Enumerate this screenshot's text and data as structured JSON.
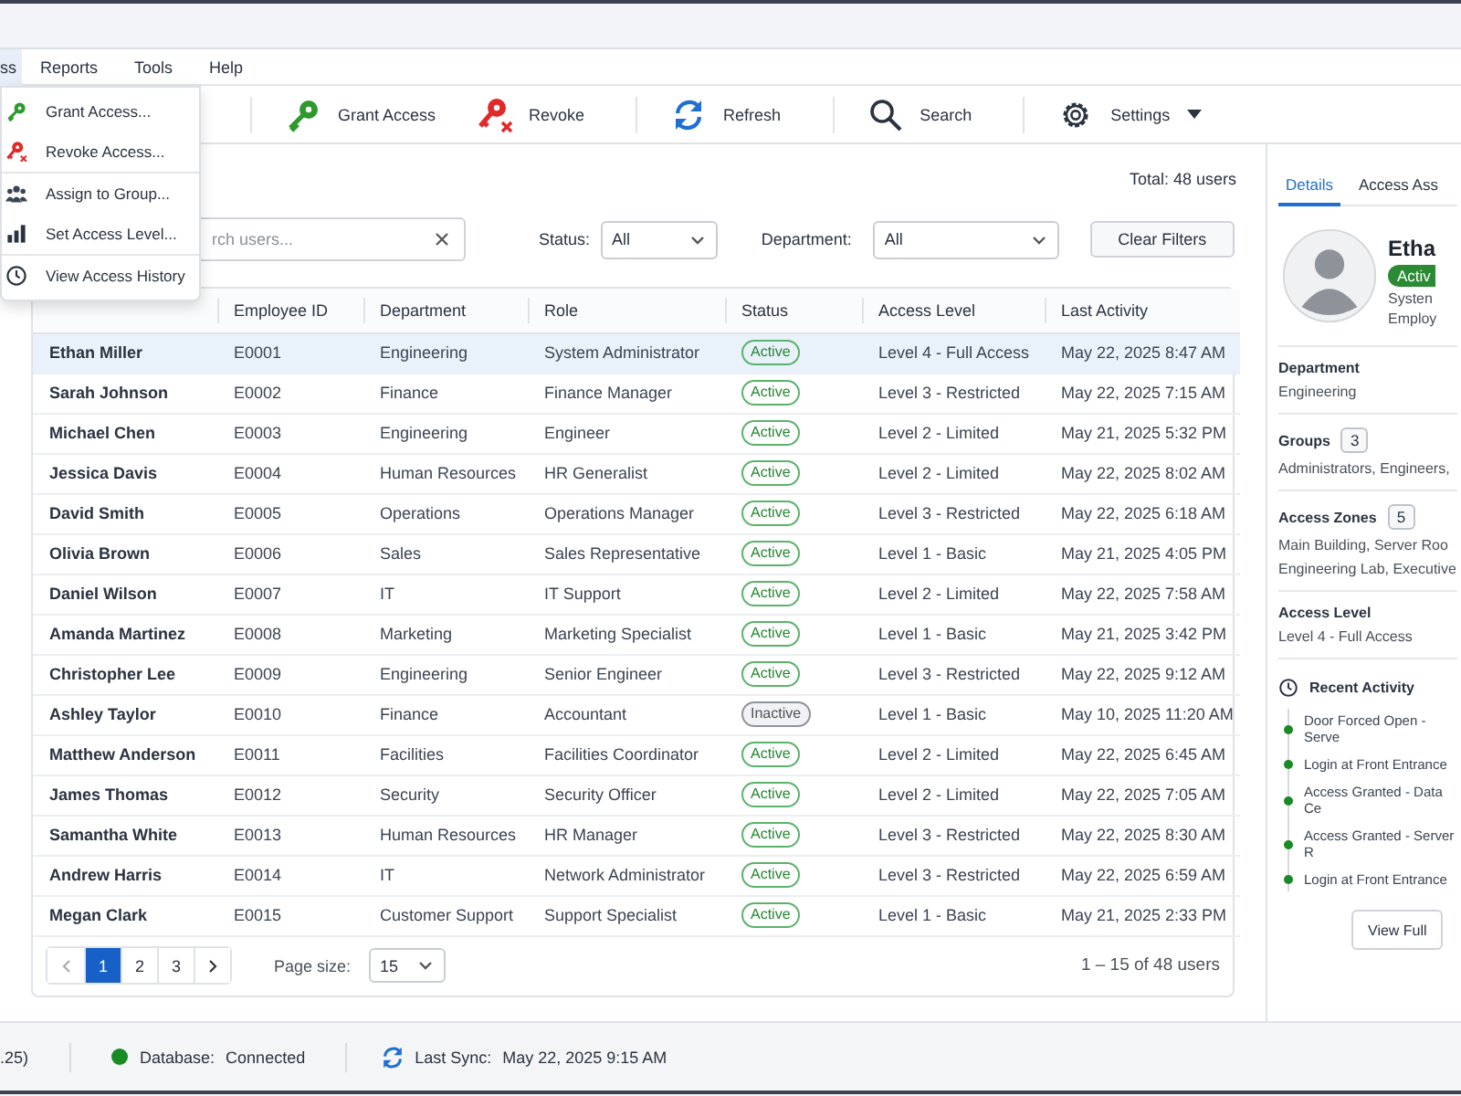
{
  "menubar": [
    {
      "label": "ss",
      "selected": true
    },
    {
      "label": "Reports",
      "selected": false
    },
    {
      "label": "Tools",
      "selected": false
    },
    {
      "label": "Help",
      "selected": false
    }
  ],
  "menu": {
    "groups": [
      [
        {
          "label": "Grant Access...",
          "kind": "grant"
        },
        {
          "label": "Revoke Access...",
          "kind": "revoke"
        }
      ],
      [
        {
          "label": "Assign to Group...",
          "kind": "group"
        },
        {
          "label": "Set Access Level...",
          "kind": "level"
        }
      ],
      [
        {
          "label": "View Access History",
          "kind": "history"
        }
      ]
    ]
  },
  "toolbar": [
    [
      {
        "label": "Grant Access",
        "kind": "grant",
        "dropdown": false
      },
      {
        "label": "Revoke",
        "kind": "revoke",
        "dropdown": false
      }
    ],
    [
      {
        "label": "Refresh",
        "kind": "refresh",
        "dropdown": false
      }
    ],
    [
      {
        "label": "Search",
        "kind": "search",
        "dropdown": false
      }
    ],
    [
      {
        "label": "Settings",
        "kind": "settings",
        "dropdown": true
      }
    ]
  ],
  "total": "Total: 48 users",
  "filters": {
    "search_placeholder": "rch users...",
    "status_label": "Status:",
    "status_value": "All",
    "department_label": "Department:",
    "department_value": "All",
    "clear_button": "Clear Filters"
  },
  "table": {
    "columns": [
      "Employee ID",
      "Department",
      "Role",
      "Status",
      "Access Level",
      "Last Activity"
    ],
    "rows": [
      {
        "name": "Ethan Miller",
        "id": "E0001",
        "department": "Engineering",
        "role": "System Administrator",
        "status": "Active",
        "active": true,
        "access_level": "Level 4 - Full Access",
        "last_activity": "May 22, 2025 8:47 AM",
        "selected": true
      },
      {
        "name": "Sarah Johnson",
        "id": "E0002",
        "department": "Finance",
        "role": "Finance Manager",
        "status": "Active",
        "active": true,
        "access_level": "Level 3 - Restricted",
        "last_activity": "May 22, 2025 7:15 AM",
        "selected": false
      },
      {
        "name": "Michael Chen",
        "id": "E0003",
        "department": "Engineering",
        "role": "Engineer",
        "status": "Active",
        "active": true,
        "access_level": "Level 2 - Limited",
        "last_activity": "May 21, 2025 5:32 PM",
        "selected": false
      },
      {
        "name": "Jessica Davis",
        "id": "E0004",
        "department": "Human Resources",
        "role": "HR Generalist",
        "status": "Active",
        "active": true,
        "access_level": "Level 2 - Limited",
        "last_activity": "May 22, 2025 8:02 AM",
        "selected": false
      },
      {
        "name": "David Smith",
        "id": "E0005",
        "department": "Operations",
        "role": "Operations Manager",
        "status": "Active",
        "active": true,
        "access_level": "Level 3 - Restricted",
        "last_activity": "May 22, 2025 6:18 AM",
        "selected": false
      },
      {
        "name": "Olivia Brown",
        "id": "E0006",
        "department": "Sales",
        "role": "Sales Representative",
        "status": "Active",
        "active": true,
        "access_level": "Level 1 - Basic",
        "last_activity": "May 21, 2025 4:05 PM",
        "selected": false
      },
      {
        "name": "Daniel Wilson",
        "id": "E0007",
        "department": "IT",
        "role": "IT Support",
        "status": "Active",
        "active": true,
        "access_level": "Level 2 - Limited",
        "last_activity": "May 22, 2025 7:58 AM",
        "selected": false
      },
      {
        "name": "Amanda Martinez",
        "id": "E0008",
        "department": "Marketing",
        "role": "Marketing Specialist",
        "status": "Active",
        "active": true,
        "access_level": "Level 1 - Basic",
        "last_activity": "May 21, 2025 3:42 PM",
        "selected": false
      },
      {
        "name": "Christopher Lee",
        "id": "E0009",
        "department": "Engineering",
        "role": "Senior Engineer",
        "status": "Active",
        "active": true,
        "access_level": "Level 3 - Restricted",
        "last_activity": "May 22, 2025 9:12 AM",
        "selected": false
      },
      {
        "name": "Ashley Taylor",
        "id": "E0010",
        "department": "Finance",
        "role": "Accountant",
        "status": "Inactive",
        "active": false,
        "access_level": "Level 1 - Basic",
        "last_activity": "May 10, 2025 11:20 AM",
        "selected": false
      },
      {
        "name": "Matthew Anderson",
        "id": "E0011",
        "department": "Facilities",
        "role": "Facilities Coordinator",
        "status": "Active",
        "active": true,
        "access_level": "Level 2 - Limited",
        "last_activity": "May 22, 2025 6:45 AM",
        "selected": false
      },
      {
        "name": "James Thomas",
        "id": "E0012",
        "department": "Security",
        "role": "Security Officer",
        "status": "Active",
        "active": true,
        "access_level": "Level 2 - Limited",
        "last_activity": "May 22, 2025 7:05 AM",
        "selected": false
      },
      {
        "name": "Samantha White",
        "id": "E0013",
        "department": "Human Resources",
        "role": "HR Manager",
        "status": "Active",
        "active": true,
        "access_level": "Level 3 - Restricted",
        "last_activity": "May 22, 2025 8:30 AM",
        "selected": false
      },
      {
        "name": "Andrew Harris",
        "id": "E0014",
        "department": "IT",
        "role": "Network Administrator",
        "status": "Active",
        "active": true,
        "access_level": "Level 3 - Restricted",
        "last_activity": "May 22, 2025 6:59 AM",
        "selected": false
      },
      {
        "name": "Megan Clark",
        "id": "E0015",
        "department": "Customer Support",
        "role": "Support Specialist",
        "status": "Active",
        "active": true,
        "access_level": "Level 1 - Basic",
        "last_activity": "May 21, 2025 2:33 PM",
        "selected": false
      }
    ]
  },
  "pagination": {
    "pages": [
      {
        "label": "1",
        "selected": true
      },
      {
        "label": "2",
        "selected": false
      },
      {
        "label": "3",
        "selected": false
      }
    ],
    "page_size_label": "Page size:",
    "page_size": "15",
    "summary": "1 – 15 of 48 users"
  },
  "details": {
    "tabs": [
      {
        "label": "Details",
        "selected": true
      },
      {
        "label": "Access Ass",
        "selected": false
      }
    ],
    "name": "Etha",
    "status": "Activ",
    "active": true,
    "role": "Systen",
    "employee": "Employ",
    "sections": [
      {
        "label": "Department",
        "lines": [
          "Engineering"
        ]
      },
      {
        "label": "Groups",
        "count": "3",
        "lines": [
          "Administrators, Engineers,"
        ]
      },
      {
        "label": "Access Zones",
        "count": "5",
        "lines": [
          "Main Building, Server Roo",
          "Engineering Lab, Executive"
        ]
      },
      {
        "label": "Access Level",
        "lines": [
          "Level 4 - Full Access"
        ]
      }
    ],
    "activity_title": "Recent Activity",
    "activity": [
      "Door Forced Open - Serve",
      "Login at Front Entrance",
      "Access Granted - Data Ce",
      "Access Granted - Server R",
      "Login at Front Entrance"
    ],
    "view_button": "View Full"
  },
  "status_bar": {
    "version": ".25)",
    "database_label": "Database:",
    "database_value": "Connected",
    "connected": true,
    "sync_label": "Last Sync:",
    "sync_value": "May 22, 2025 9:15 AM"
  }
}
